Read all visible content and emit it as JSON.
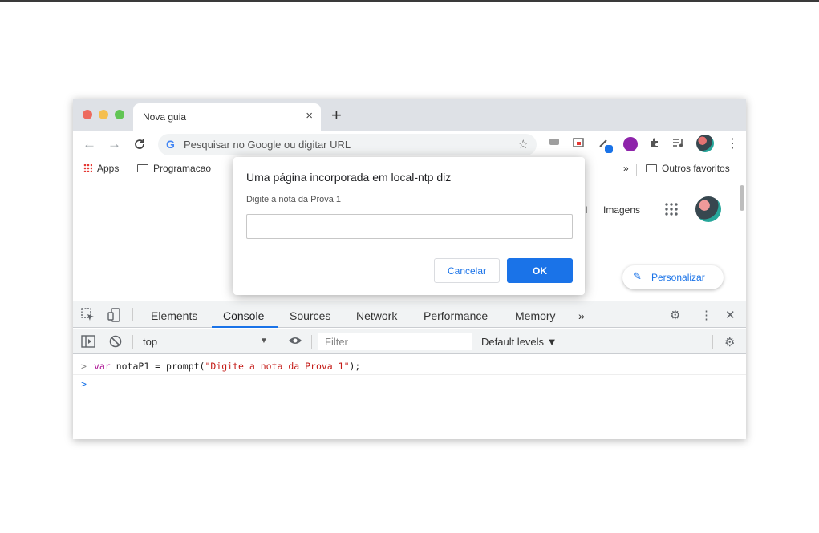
{
  "browser": {
    "tab": {
      "title": "Nova guia",
      "close_icon": "×"
    },
    "new_tab_icon": "+",
    "nav": {
      "back_icon": "←",
      "forward_icon": "→",
      "reload_icon": "C"
    },
    "omnibox": {
      "google_icon": "G",
      "placeholder": "Pesquisar no Google ou digitar URL",
      "star_icon": "☆"
    },
    "menu_icon": "⋮",
    "bookmarks": {
      "apps": "Apps",
      "programacao": "Programacao",
      "more_icon": "»",
      "outros_favoritos": "Outros favoritos"
    }
  },
  "page": {
    "gmail_fragment": "il",
    "imagens": "Imagens",
    "personalizar": "Personalizar",
    "pencil_icon": "✎"
  },
  "dialog": {
    "title": "Uma página incorporada em local-ntp diz",
    "message": "Digite a nota da Prova 1",
    "input_value": "",
    "cancel_label": "Cancelar",
    "ok_label": "OK"
  },
  "devtools": {
    "tabs": [
      "Elements",
      "Console",
      "Sources",
      "Network",
      "Performance",
      "Memory"
    ],
    "active_tab": "Console",
    "more_tabs_icon": "»",
    "settings_icon": "⚙",
    "kebab_icon": "⋮",
    "close_icon": "✕",
    "context": "top",
    "context_arrow": "▼",
    "filter_placeholder": "Filter",
    "levels": "Default levels ▼",
    "console": {
      "prompt_symbol": ">",
      "line1": {
        "keyword": "var",
        "code1": " notaP1 = prompt(",
        "string": "\"Digite a nota da Prova 1\"",
        "code2": ");"
      }
    }
  },
  "colors": {
    "accent": "#1a73e8",
    "tabstrip": "#dee1e6"
  }
}
